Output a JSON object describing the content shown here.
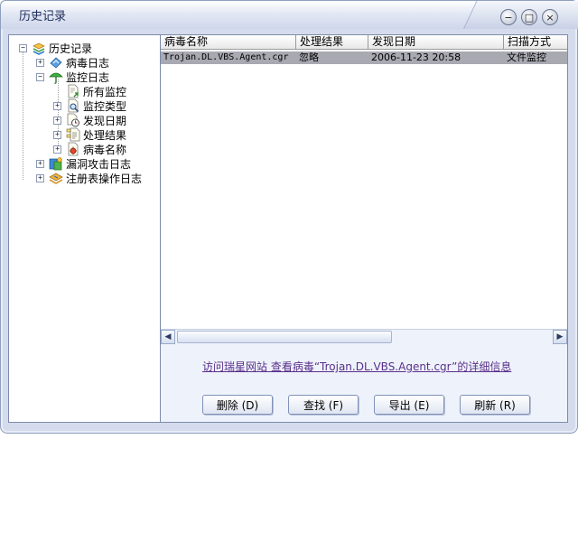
{
  "window": {
    "title": "历史记录",
    "controls": {
      "minimize": "−",
      "maximize": "□",
      "close": "×"
    }
  },
  "tree": {
    "root": {
      "label": "历史记录",
      "icon": "history-stack-icon",
      "expander": "−"
    },
    "items": [
      {
        "label": "病毒日志",
        "icon": "virus-log-icon",
        "expander": "+"
      },
      {
        "label": "监控日志",
        "icon": "umbrella-monitor-icon",
        "expander": "−"
      },
      {
        "label": "所有监控",
        "icon": "document-arrow-icon",
        "expander": ""
      },
      {
        "label": "监控类型",
        "icon": "magnifier-document-icon",
        "expander": "+"
      },
      {
        "label": "发现日期",
        "icon": "clock-document-icon",
        "expander": "+"
      },
      {
        "label": "处理结果",
        "icon": "document-tree-icon",
        "expander": "+"
      },
      {
        "label": "病毒名称",
        "icon": "virus-document-icon",
        "expander": "+"
      },
      {
        "label": "漏洞攻击日志",
        "icon": "shield-attack-icon",
        "expander": "+"
      },
      {
        "label": "注册表操作日志",
        "icon": "registry-icon",
        "expander": "+"
      }
    ]
  },
  "grid": {
    "columns": [
      "病毒名称",
      "处理结果",
      "发现日期",
      "扫描方式"
    ],
    "rows": [
      [
        "Trojan.DL.VBS.Agent.cgr",
        "忽略",
        "2006-11-23 20:58",
        "文件监控"
      ]
    ]
  },
  "scrollbar": {
    "left_arrow": "◀",
    "right_arrow": "▶"
  },
  "detail_link": "访问瑞星网站 查看病毒“Trojan.DL.VBS.Agent.cgr”的详细信息",
  "buttons": {
    "delete": "删除 (D)",
    "find": "查找 (F)",
    "export": "导出 (E)",
    "refresh": "刷新 (R)"
  },
  "colors": {
    "selected_row": "#a9a9b2",
    "link": "#5a2f8a",
    "window_border": "#8f9fbe"
  }
}
